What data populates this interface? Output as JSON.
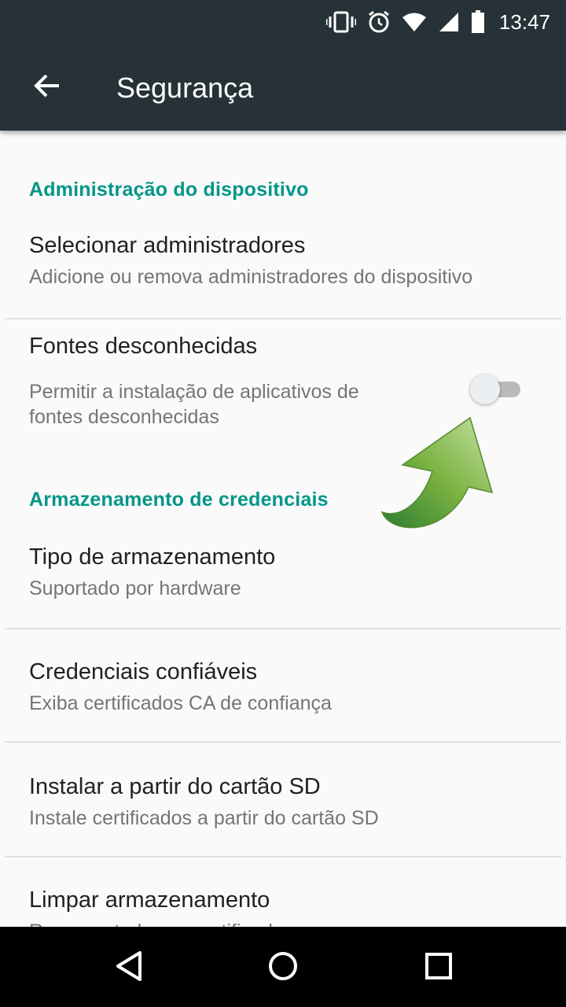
{
  "status_bar": {
    "time": "13:47",
    "icons": [
      "vibrate-icon",
      "alarm-icon",
      "wifi-icon",
      "signal-icon",
      "battery-icon"
    ]
  },
  "app_bar": {
    "title": "Segurança",
    "back_icon": "arrow-back-icon"
  },
  "sections": [
    {
      "header": "Administração do dispositivo",
      "items": [
        {
          "title": "Selecionar administradores",
          "summary": "Adicione ou remova administradores do dispositivo"
        },
        {
          "title": "Fontes desconhecidas",
          "summary_line1": "Permitir a instalação de aplicativos de",
          "summary_line2": "fontes desconhecidas",
          "switch_on": false
        }
      ]
    },
    {
      "header": "Armazenamento de credenciais",
      "items": [
        {
          "title": "Tipo de armazenamento",
          "summary": "Suportado por hardware"
        },
        {
          "title": "Credenciais confiáveis",
          "summary": "Exiba certificados CA de confiança"
        },
        {
          "title": "Instalar a partir do cartão SD",
          "summary": "Instale certificados a partir do cartão SD"
        },
        {
          "title": "Limpar armazenamento",
          "summary": "Remover todos os certificados"
        }
      ]
    }
  ],
  "nav_bar": {
    "icons": [
      "back-triangle-icon",
      "home-circle-icon",
      "recents-square-icon"
    ]
  },
  "colors": {
    "bar": "#263238",
    "accent": "#009688",
    "background": "#fafafa",
    "arrow_green": "#7cb342"
  }
}
